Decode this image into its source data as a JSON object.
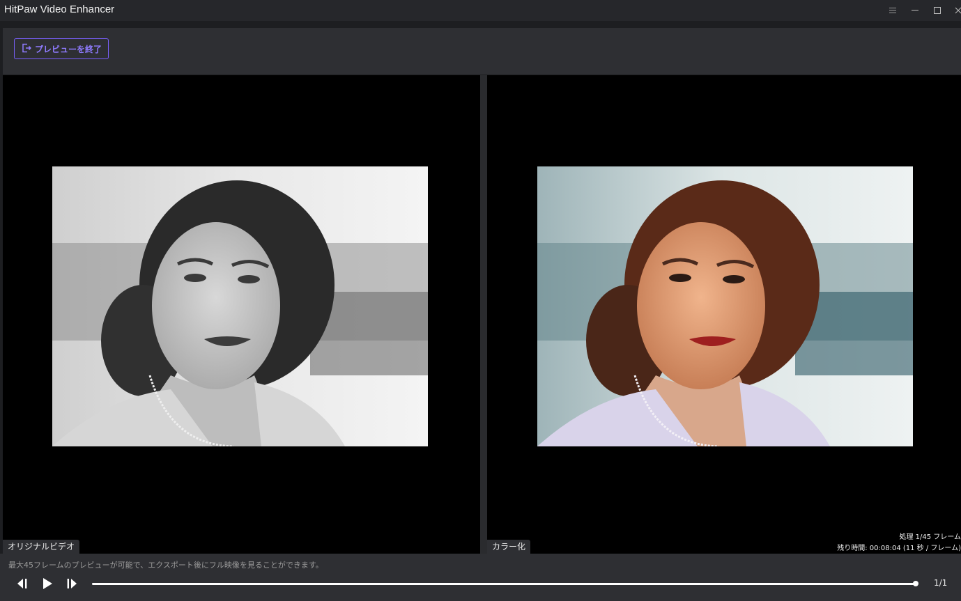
{
  "window": {
    "title": "HitPaw Video Enhancer",
    "controls": [
      "menu-icon",
      "minimize-icon",
      "maximize-icon",
      "close-icon"
    ]
  },
  "toolbar": {
    "exit_preview_label": "プレビューを終了",
    "exit_icon": "exit-icon",
    "accent_color": "#7b61ff"
  },
  "panes": {
    "left": {
      "label": "オリジナルビデオ"
    },
    "right": {
      "label": "カラー化",
      "status_processing": "処理 1/45 フレーム",
      "status_remaining": "残り時間: 00:08:04 (11 秒 / フレーム)"
    }
  },
  "bottom": {
    "notice": "最大45フレームのプレビューが可能で、エクスポート後にフル映像を見ることができます。",
    "controls": [
      "previous-frame-icon",
      "play-icon",
      "next-frame-icon"
    ],
    "progress": 1.0,
    "page_count": "1/1"
  }
}
